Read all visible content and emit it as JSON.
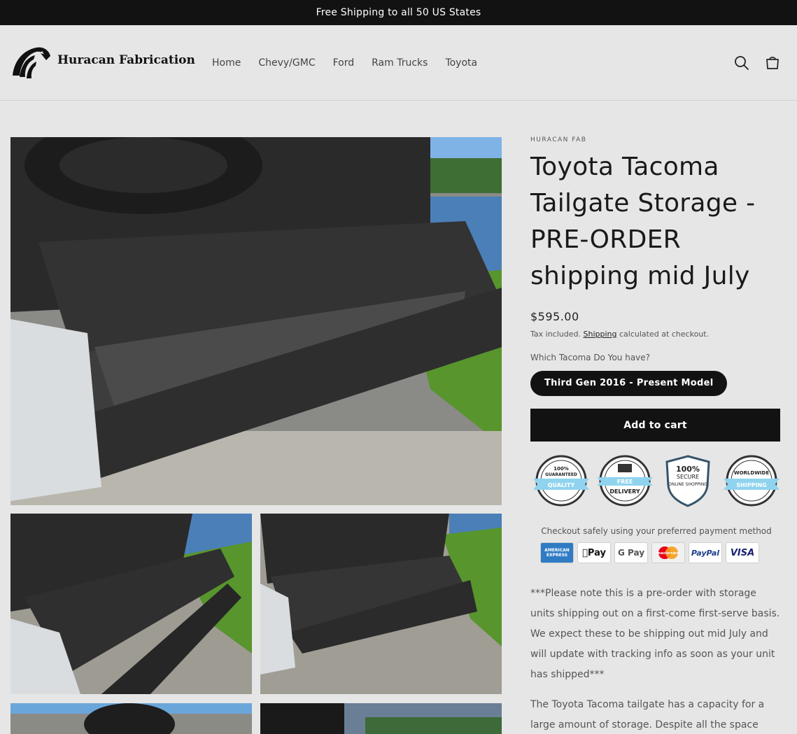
{
  "announcement": "Free Shipping to all 50 US States",
  "brand": {
    "name": "Huracan Fabrication"
  },
  "nav": [
    "Home",
    "Chevy/GMC",
    "Ford",
    "Ram Trucks",
    "Toyota"
  ],
  "product": {
    "vendor": "HURACAN FAB",
    "title": "Toyota Tacoma Tailgate Storage - PRE-ORDER shipping mid July",
    "price": "$595.00",
    "tax_prefix": "Tax included.",
    "tax_link": "Shipping",
    "tax_suffix": "calculated at checkout.",
    "variant_label": "Which Tacoma Do You have?",
    "variant_selected": "Third Gen 2016 - Present Model",
    "add_to_cart": "Add to cart"
  },
  "badges": [
    {
      "line1": "100%",
      "line2": "GUARANTEED",
      "ribbon": "QUALITY"
    },
    {
      "line1": "",
      "line2": "FREE",
      "ribbon": "DELIVERY"
    },
    {
      "line1": "100%",
      "line2": "SECURE",
      "ribbon": "ONLINE SHOPPING"
    },
    {
      "line1": "WORLDWIDE",
      "line2": "",
      "ribbon": "SHIPPING"
    }
  ],
  "checkout_text": "Checkout safely using your preferred payment method",
  "payments": [
    "AMERICAN EXPRESS",
    "Pay",
    "G Pay",
    "mastercard",
    "PayPal",
    "VISA"
  ],
  "description": [
    "***Please note this is a pre-order with storage units shipping out on a first-come first-serve basis. We expect these to be shipping out mid July and will update with tracking info as soon as your unit has shipped***",
    "The Toyota Tacoma tailgate has a capacity for a large amount of storage. Despite all the space"
  ],
  "colors": {
    "dark": "#121212",
    "background": "#e6e6e6",
    "grass": "#4e8b2a",
    "sky": "#6aa6da"
  },
  "icons": [
    "eagle-logo-icon",
    "search-icon",
    "cart-icon"
  ]
}
